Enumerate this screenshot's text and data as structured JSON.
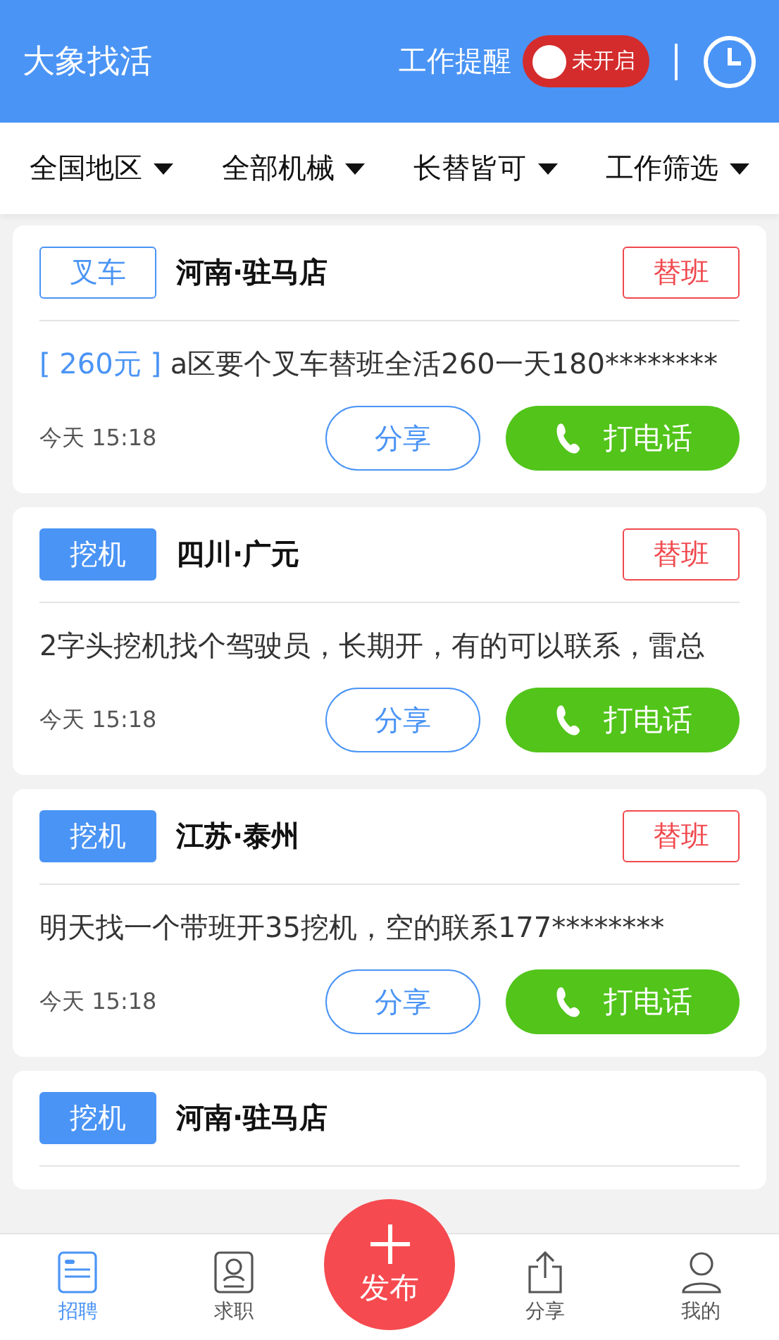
{
  "header": {
    "title": "大象找活",
    "reminder_label": "工作提醒",
    "reminder_toggle": {
      "on": false,
      "label": "未开启"
    }
  },
  "filters": [
    {
      "label": "全国地区"
    },
    {
      "label": "全部机械"
    },
    {
      "label": "长替皆可"
    },
    {
      "label": "工作筛选"
    }
  ],
  "posts": [
    {
      "tag": {
        "label": "叉车",
        "kind": "outline"
      },
      "location": "河南·驻马店",
      "badge": "替班",
      "price": "[ 260元 ]",
      "text": "a区要个叉车替班全活260一天180********",
      "time": "今天 15:18",
      "share": "分享",
      "call": "打电话"
    },
    {
      "tag": {
        "label": "挖机",
        "kind": "filled"
      },
      "location": "四川·广元",
      "badge": "替班",
      "text": "2字头挖机找个驾驶员，长期开，有的可以联系，雷总",
      "time": "今天 15:18",
      "share": "分享",
      "call": "打电话"
    },
    {
      "tag": {
        "label": "挖机",
        "kind": "filled"
      },
      "location": "江苏·泰州",
      "badge": "替班",
      "text": "明天找一个带班开35挖机，空的联系177********",
      "time": "今天 15:18",
      "share": "分享",
      "call": "打电话"
    },
    {
      "tag": {
        "label": "挖机",
        "kind": "filled"
      },
      "location": "河南·驻马店"
    }
  ],
  "publish": {
    "label": "发布"
  },
  "tabs": [
    {
      "label": "招聘",
      "selected": true
    },
    {
      "label": "求职",
      "selected": false
    },
    {
      "label": "分享",
      "selected": false
    },
    {
      "label": "我的",
      "selected": false
    }
  ]
}
